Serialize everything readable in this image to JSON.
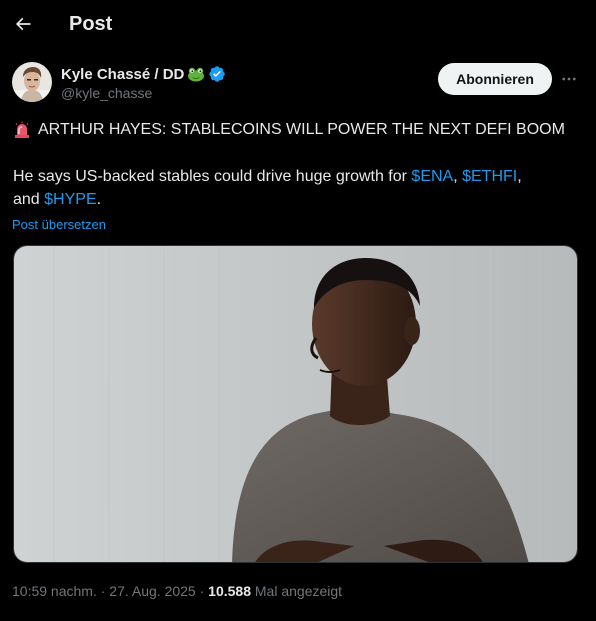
{
  "header": {
    "title": "Post",
    "back_icon": "arrow-left-icon"
  },
  "author": {
    "display_name": "Kyle Chassé / DD",
    "name_emoji": "frog-icon",
    "verified_badge": "verified-badge-icon",
    "handle": "@kyle_chasse",
    "subscribe_label": "Abonnieren",
    "more_icon": "more-dots-icon"
  },
  "tweet": {
    "emoji": "police-siren-icon",
    "headline": "ARTHUR HAYES: STABLECOINS WILL POWER THE NEXT DEFI BOOM",
    "body_prefix": "He says US-backed stables could drive huge growth for ",
    "cashtag_1": "$ENA",
    "sep_1": ", ",
    "cashtag_2": "$ETHFI",
    "sep_2": ",",
    "body_and": "and ",
    "cashtag_3": "$HYPE",
    "body_end": ".",
    "translate_label": "Post übersetzen"
  },
  "media": {
    "kind": "photo-portrait"
  },
  "meta": {
    "time": "10:59 nachm.",
    "sep_1": " · ",
    "date": "27. Aug. 2025",
    "sep_2": " · ",
    "views": "10.588",
    "views_label": " Mal angezeigt"
  },
  "colors": {
    "background": "#000000",
    "text": "#e7e9ea",
    "muted": "#71767b",
    "link": "#1d9bf0",
    "button_bg": "#eff3f4"
  }
}
